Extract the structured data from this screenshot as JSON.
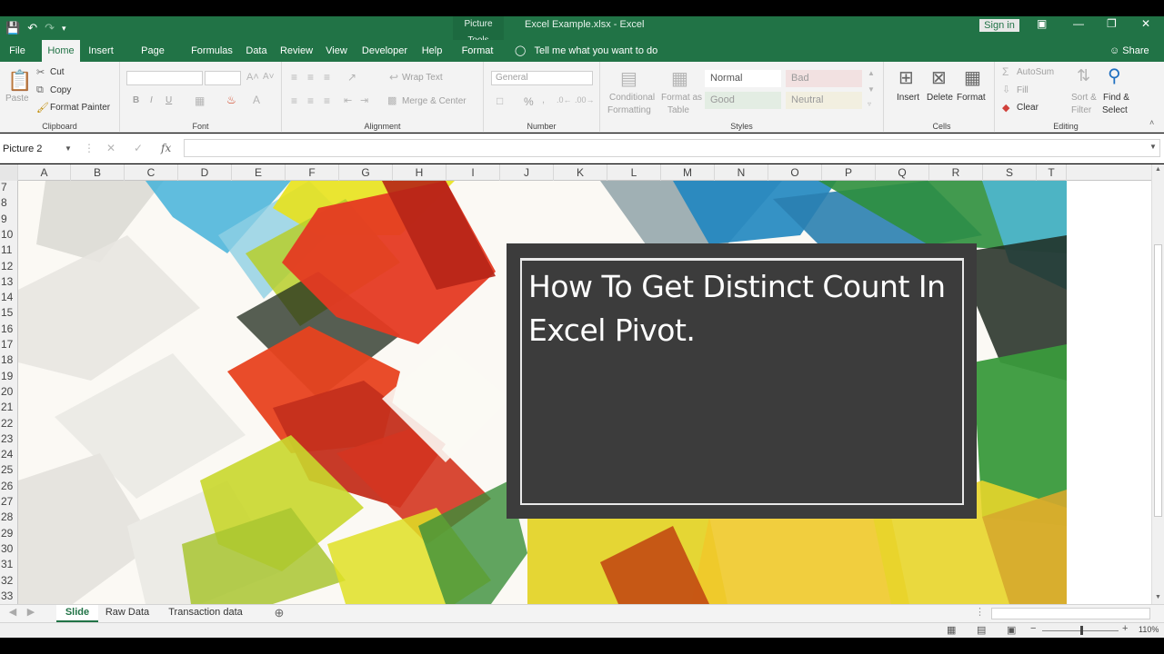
{
  "titlebar": {
    "context_tab": "Picture Tools",
    "document_title": "Excel Example.xlsx  -  Excel",
    "signin": "Sign in",
    "share": "Share",
    "tell_me": "Tell me what you want to do"
  },
  "ribbon_tabs": [
    "File",
    "Home",
    "Insert",
    "Page Layout",
    "Formulas",
    "Data",
    "Review",
    "View",
    "Developer",
    "Help",
    "Format"
  ],
  "active_tab": "Home",
  "clipboard": {
    "label": "Clipboard",
    "paste": "Paste",
    "cut": "Cut",
    "copy": "Copy",
    "format_painter": "Format Painter"
  },
  "font": {
    "label": "Font",
    "bold": "B",
    "italic": "I",
    "underline": "U"
  },
  "alignment": {
    "label": "Alignment",
    "wrap_text": "Wrap Text",
    "merge_center": "Merge & Center"
  },
  "number": {
    "label": "Number",
    "format_value": "General",
    "percent": "%"
  },
  "styles": {
    "label": "Styles",
    "conditional_formatting": [
      "Conditional",
      "Formatting"
    ],
    "format_as_table": [
      "Format as",
      "Table"
    ],
    "cells": [
      "Normal",
      "Bad",
      "Good",
      "Neutral"
    ]
  },
  "cells_group": {
    "label": "Cells",
    "insert": "Insert",
    "delete": "Delete",
    "format": "Format"
  },
  "editing": {
    "label": "Editing",
    "autosum": "AutoSum",
    "fill": "Fill",
    "clear": "Clear",
    "sort_filter": [
      "Sort &",
      "Filter"
    ],
    "find_select": [
      "Find &",
      "Select"
    ]
  },
  "formula_bar": {
    "name_box": "Picture 2",
    "fx": "fx",
    "formula": ""
  },
  "columns": [
    "A",
    "B",
    "C",
    "D",
    "E",
    "F",
    "G",
    "H",
    "I",
    "J",
    "K",
    "L",
    "M",
    "N",
    "O",
    "P",
    "Q",
    "R",
    "S",
    "T"
  ],
  "rows": [
    "7",
    "8",
    "9",
    "10",
    "11",
    "12",
    "13",
    "14",
    "15",
    "16",
    "17",
    "18",
    "19",
    "20",
    "21",
    "22",
    "23",
    "24",
    "25",
    "26",
    "27",
    "28",
    "29",
    "30",
    "31",
    "32",
    "33"
  ],
  "slide": {
    "title_line1": "How To Get Distinct Count In",
    "title_line2": "Excel Pivot."
  },
  "sheet_tabs": [
    "Slide",
    "Raw Data",
    "Transaction data"
  ],
  "active_sheet": "Slide",
  "status": {
    "zoom": "110%"
  },
  "colors": {
    "excel_green": "#217346",
    "slide_panel": "#3c3c3c",
    "shape_red": "#e23a23",
    "shape_yellow": "#e6dc1a",
    "shape_green": "#2f8a3a",
    "shape_blue": "#2a8fc0"
  }
}
